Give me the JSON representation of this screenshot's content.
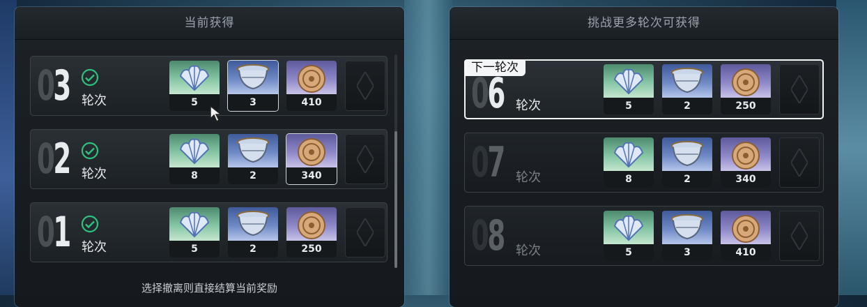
{
  "left_panel": {
    "title": "当前获得",
    "rows": [
      {
        "round_prefix": "0",
        "round_digit": "3",
        "round_label": "轮次",
        "completed": true,
        "items": [
          {
            "name": "blue-seashell-icon",
            "qty": "5",
            "highlighted": false
          },
          {
            "name": "crystal-bowl-icon",
            "qty": "3",
            "highlighted": true
          },
          {
            "name": "gold-coin-icon",
            "qty": "410",
            "highlighted": false
          }
        ]
      },
      {
        "round_prefix": "0",
        "round_digit": "2",
        "round_label": "轮次",
        "completed": true,
        "items": [
          {
            "name": "blue-seashell-icon",
            "qty": "8",
            "highlighted": false
          },
          {
            "name": "crystal-bowl-icon",
            "qty": "2",
            "highlighted": false
          },
          {
            "name": "gold-coin-icon",
            "qty": "340",
            "highlighted": true
          }
        ]
      },
      {
        "round_prefix": "0",
        "round_digit": "1",
        "round_label": "轮次",
        "completed": true,
        "items": [
          {
            "name": "blue-seashell-icon",
            "qty": "5",
            "highlighted": false
          },
          {
            "name": "crystal-bowl-icon",
            "qty": "2",
            "highlighted": false
          },
          {
            "name": "gold-coin-icon",
            "qty": "250",
            "highlighted": false
          }
        ]
      }
    ],
    "footer": "选择撤离则直接结算当前奖励"
  },
  "right_panel": {
    "title": "挑战更多轮次可获得",
    "next_tag": "下一轮次",
    "rows": [
      {
        "round_prefix": "0",
        "round_digit": "6",
        "round_label": "轮次",
        "is_next": true,
        "items": [
          {
            "name": "blue-seashell-icon",
            "qty": "5"
          },
          {
            "name": "crystal-bowl-icon",
            "qty": "2"
          },
          {
            "name": "gold-coin-icon",
            "qty": "250"
          }
        ]
      },
      {
        "round_prefix": "0",
        "round_digit": "7",
        "round_label": "轮次",
        "is_next": false,
        "items": [
          {
            "name": "blue-seashell-icon",
            "qty": "8"
          },
          {
            "name": "crystal-bowl-icon",
            "qty": "2"
          },
          {
            "name": "gold-coin-icon",
            "qty": "340"
          }
        ]
      },
      {
        "round_prefix": "0",
        "round_digit": "8",
        "round_label": "轮次",
        "is_next": false,
        "items": [
          {
            "name": "blue-seashell-icon",
            "qty": "5"
          },
          {
            "name": "crystal-bowl-icon",
            "qty": "3"
          },
          {
            "name": "gold-coin-icon",
            "qty": "410"
          }
        ]
      }
    ]
  },
  "colors": {
    "check": "#2ec27e",
    "next_border": "#f2f4f6"
  }
}
